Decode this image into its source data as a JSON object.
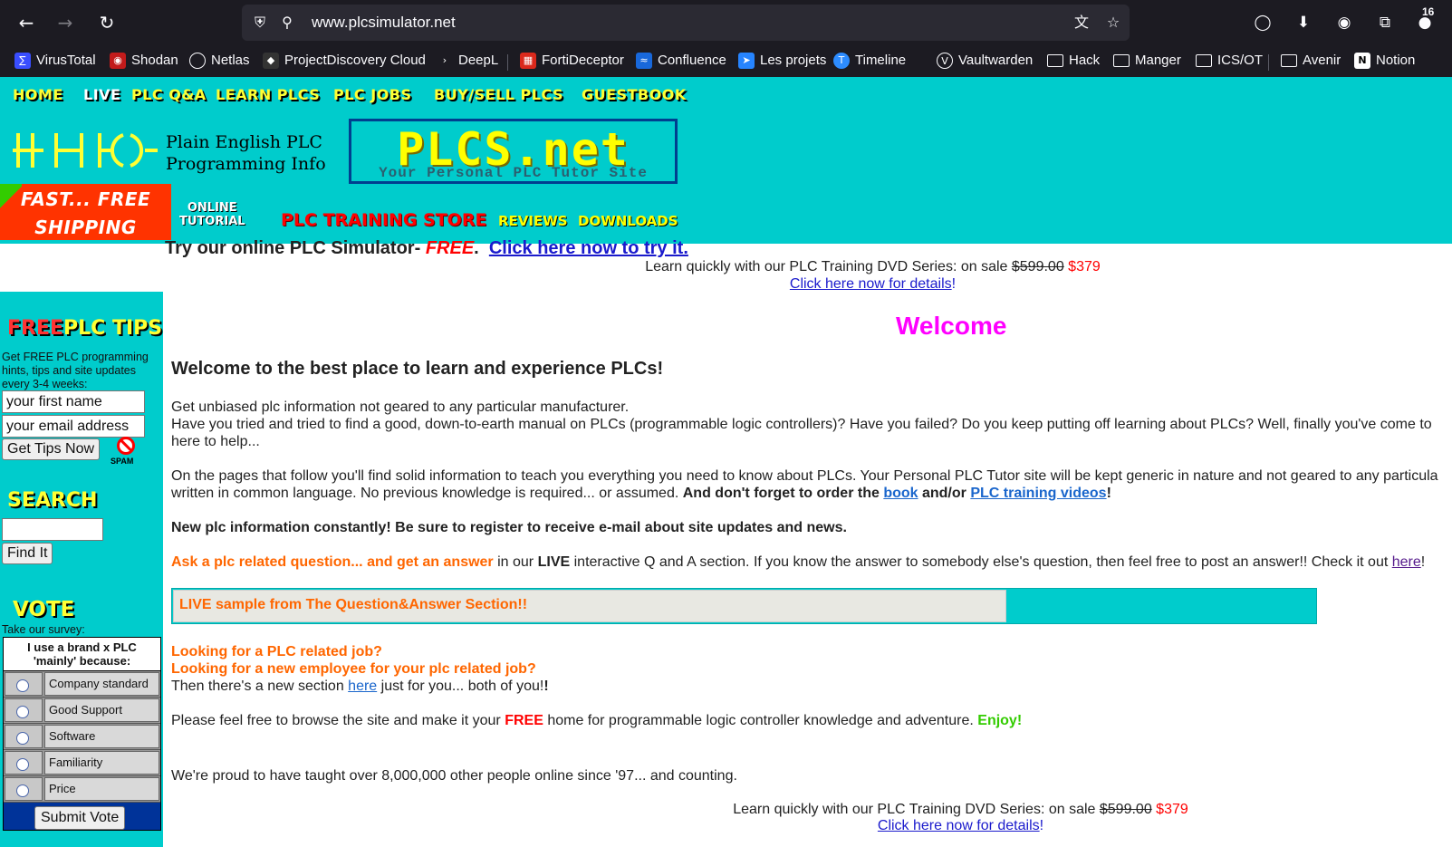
{
  "browser": {
    "url": "www.plcsimulator.net",
    "notification_count": "16",
    "bookmarks": [
      {
        "label": "VirusTotal"
      },
      {
        "label": "Shodan"
      },
      {
        "label": "Netlas"
      },
      {
        "label": "ProjectDiscovery Cloud"
      },
      {
        "label": "DeepL"
      },
      {
        "label": "FortiDeceptor"
      },
      {
        "label": "Confluence"
      },
      {
        "label": "Les projets"
      },
      {
        "label": "Timeline"
      },
      {
        "label": "Vaultwarden"
      },
      {
        "label": "Hack"
      },
      {
        "label": "Manger"
      },
      {
        "label": "ICS/OT"
      },
      {
        "label": "Avenir"
      },
      {
        "label": "Notion"
      }
    ]
  },
  "header": {
    "nav": [
      "HOME",
      "LIVE",
      "PLC Q&A",
      "LEARN PLCS",
      "PLC JOBS",
      "BUY/SELL PLCS",
      "GUESTBOOK"
    ],
    "tagline_1": "Plain English PLC",
    "tagline_2": "Programming Info",
    "site_title": "PLCS.net",
    "site_subtitle": "Your Personal PLC Tutor Site",
    "shipping_1": "FAST... FREE",
    "shipping_2": "SHIPPING",
    "online_1": "ONLINE",
    "online_2": "TUTORIAL",
    "store": "PLC TRAINING STORE",
    "reviews": "REVIEWS",
    "downloads": "DOWNLOADS"
  },
  "promo": {
    "try_text": "Try our online PLC Simulator-",
    "try_free": "FREE",
    "try_link": "Click here now to try it.",
    "sale_text": "Learn quickly with our PLC Training DVD Series: on sale",
    "old_price": "$599.00",
    "new_price": "$379",
    "details_link": "Click here now for details",
    "bang": "!"
  },
  "sidebar": {
    "tips_head_1": "FREE",
    "tips_head_2": "PLC TIPS",
    "tips_desc": "Get FREE PLC programming hints, tips and site updates every 3-4 weeks:",
    "first_name": "your first name",
    "email": "your email address",
    "get_tips": "Get Tips Now",
    "spam": "SPAM",
    "search_head": "SEARCH",
    "search_value": "",
    "find_it": "Find It",
    "vote_head": "VOTE",
    "vote_desc": "Take our survey:",
    "poll_question": "I use a brand x PLC 'mainly' because:",
    "poll_options": [
      "Company standard",
      "Good Support",
      "Software",
      "Familiarity",
      "Price"
    ],
    "submit_vote": "Submit Vote"
  },
  "main": {
    "welcome": "Welcome",
    "lead": "Welcome to the best place to learn and experience PLCs!",
    "p1_a": "Get unbiased plc information not geared to any particular manufacturer.",
    "p1_b": "Have you tried and tried to find a good, down-to-earth manual on PLCs (programmable logic controllers)? Have you failed? Do you keep putting off learning about PLCs? Well, finally you've come to",
    "p1_c": "here to help...",
    "p2_a": "On the pages that follow you'll find solid information to teach you everything you need to know about PLCs. Your Personal PLC Tutor site will be kept generic in nature and not geared to any particula",
    "p2_b": "written in common language. No previous knowledge is required... or assumed.",
    "p2_bold": "And don't forget to order the",
    "p2_book": "book",
    "p2_andor": "and/or",
    "p2_videos": "PLC training videos",
    "p3": "New plc information constantly! Be sure to register to receive e-mail about site updates and news.",
    "p4_orange": "Ask a plc related question... and get an answer",
    "p4_in": "in our",
    "p4_live": "LIVE",
    "p4_rest": "interactive Q and A section. If you know the answer to somebody else's question, then feel free to post an answer!! Check it out",
    "p4_here": "here",
    "live_sample": "LIVE sample from The Question&Answer Section!!",
    "job_1": "Looking for a PLC related job?",
    "job_2": "Looking for a new employee for your plc related job?",
    "job_3a": "Then there's a new section",
    "job_here": "here",
    "job_3b": "just for you... both of you!",
    "browse_a": "Please feel free to browse the site and make it your",
    "browse_free": "FREE",
    "browse_b": "home for programmable logic controller knowledge and adventure.",
    "browse_enjoy": "Enjoy!",
    "taught": "We're proud to have taught over 8,000,000 other people online since '97... and counting."
  }
}
